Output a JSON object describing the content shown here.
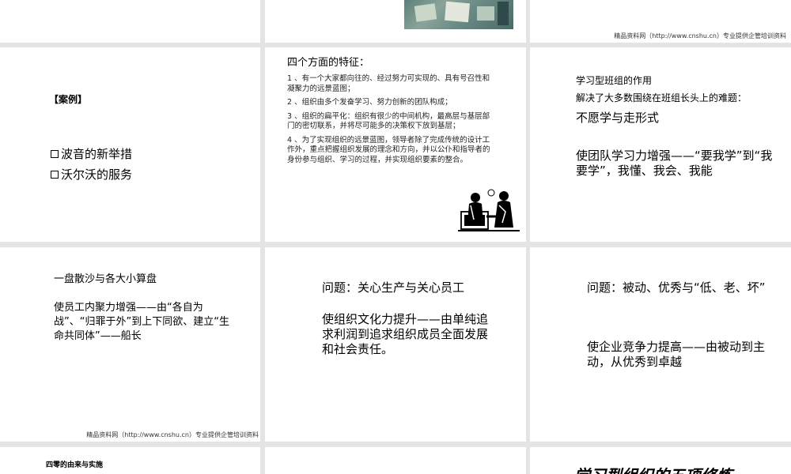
{
  "watermark": "精品资料网（http://www.cnshu.cn）专业提供企管培训资料",
  "slide_case": {
    "title": "【案例】",
    "items": [
      "波音的新举措",
      "沃尔沃的服务"
    ]
  },
  "slide_features": {
    "title": "四个方面的特征：",
    "points": [
      "1 、有一个大家都向往的、经过努力可实现的、具有号召性和凝聚力的远景蓝图；",
      "2 、组织由多个发奋学习、努力创新的团队构成；",
      "3 、组织的扁平化：组织有很少的中间机构，最高层与基层部门的密切联系，并将尽可能多的决策权下放到基层；",
      "4 、为了实现组织的远景蓝图，领导者除了完成传统的设计工作外，重点把握组织发展的理念和方向，并以公仆和指导者的身份参与组织、学习的过程，并实现组织要素的整合。"
    ]
  },
  "slide_role": {
    "title": "学习型班组的作用",
    "subtitle": "解决了大多数围绕在班组长头上的难题：",
    "problem": "不愿学与走形式",
    "result": "使团队学习力增强——“要我学”到“我要学”，我懂、我会、我能"
  },
  "slide_cohesion": {
    "problem": "一盘散沙与各大小算盘",
    "result": "使员工内聚力增强——由“各自为战”、“归罪于外”到上下同欲、建立“生命共同体”——船长"
  },
  "slide_culture": {
    "problem": "问题：关心生产与关心员工",
    "result": "使组织文化力提升——由单纯追求利润到追求组织成员全面发展和社会责任。"
  },
  "slide_compete": {
    "problem": "问题：被动、优秀与“低、老、坏”",
    "result": "使企业竞争力提高——由被动到主动，从优秀到卓越"
  },
  "slide_bottom_left": {
    "title": "四零的由来与实施"
  },
  "slide_bottom_right": {
    "title": "学习型组织的五项修炼"
  }
}
